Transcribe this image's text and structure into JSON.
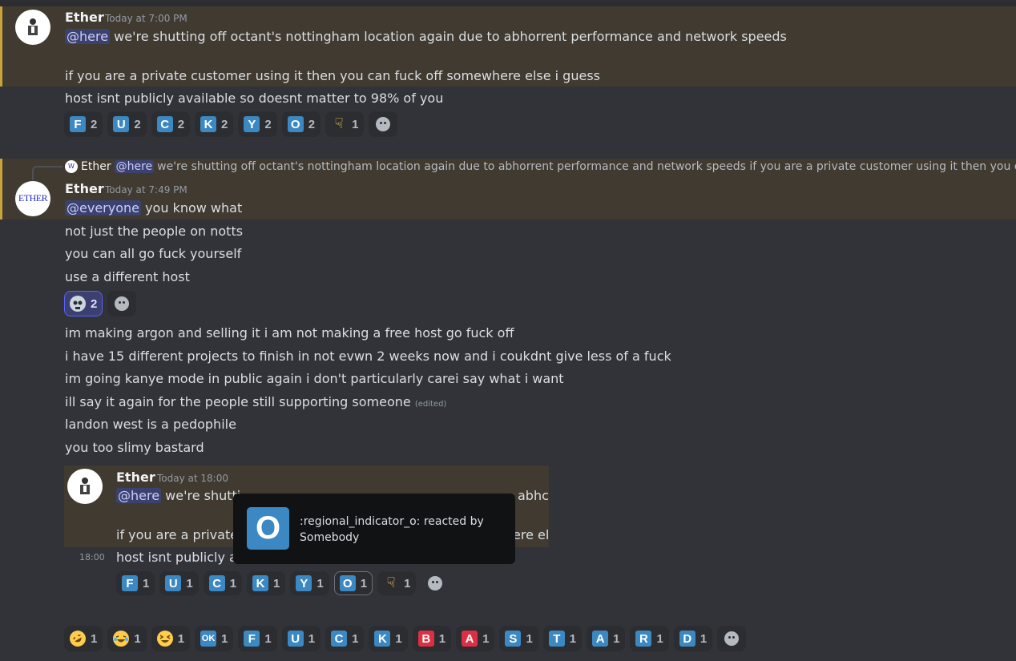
{
  "m1": {
    "username": "Ether",
    "timestamp": "Today at 7:00 PM",
    "mention": "@here",
    "line1": "we're shutting off octant's nottingham location again due to abhorrent performance and network speeds",
    "line2": "if you are a private customer using it then you can fuck off somewhere else i guess",
    "line3": "host isnt publicly available so doesnt matter to 98% of you",
    "reactions": [
      {
        "glyph": "F",
        "count": "2"
      },
      {
        "glyph": "U",
        "count": "2"
      },
      {
        "glyph": "C",
        "count": "2"
      },
      {
        "glyph": "K",
        "count": "2"
      },
      {
        "glyph": "Y",
        "count": "2"
      },
      {
        "glyph": "O",
        "count": "2"
      },
      {
        "icon": "middle-finger-icon",
        "count": "1"
      }
    ]
  },
  "reply": {
    "avatar_text": "W",
    "username": "Ether",
    "mention": "@here",
    "text": "we're shutting off octant's nottingham location again due to abhorrent performance and network speeds  if you are a private customer using it then you can fuc..."
  },
  "m2": {
    "username": "Ether",
    "timestamp": "Today at 7:49 PM",
    "avatar_text": "ETHER",
    "mention": "@everyone",
    "line1": "you know what",
    "line2": "not just the people on notts",
    "line3": "you can all go fuck yourself",
    "line4": "use a different host",
    "skull_count": "2",
    "line5": "im making argon and selling it i am not making a free host go fuck off",
    "line6": "i have 15 different projects to finish in not evwn 2 weeks now and i coukdnt give less of a fuck",
    "line7": "im going kanye mode in public again i don't particularly carei say what i want",
    "line8": "ill say it again for the people still supporting someone",
    "edited": "(edited)",
    "line9": "landon west is a pedophile",
    "line10": "you too slimy bastard"
  },
  "embed": {
    "username": "Ether",
    "timestamp": "Today at 18:00",
    "mention": "@here",
    "line1_a": "we're shutti",
    "line1_b": "abhc",
    "line2_a": "if you are a private c",
    "line2_b": "ere el",
    "side_time": "18:00",
    "line3": "host isnt publicly av",
    "reactions": [
      {
        "glyph": "F",
        "count": "1"
      },
      {
        "glyph": "U",
        "count": "1"
      },
      {
        "glyph": "C",
        "count": "1"
      },
      {
        "glyph": "K",
        "count": "1"
      },
      {
        "glyph": "Y",
        "count": "1"
      },
      {
        "glyph": "O",
        "count": "1"
      },
      {
        "icon": "middle-finger-icon",
        "count": "1"
      }
    ]
  },
  "tooltip": {
    "glyph": "O",
    "text": ":regional_indicator_o: reacted by Somebody"
  },
  "bottom_reactions": [
    {
      "icon": "rofl-icon",
      "count": "1"
    },
    {
      "icon": "joy-icon",
      "count": "1"
    },
    {
      "icon": "laughing-icon",
      "count": "1"
    },
    {
      "glyph": "OK",
      "count": "1"
    },
    {
      "glyph": "F",
      "count": "1"
    },
    {
      "glyph": "U",
      "count": "1"
    },
    {
      "glyph": "C",
      "count": "1"
    },
    {
      "glyph": "K",
      "count": "1"
    },
    {
      "glyph": "B",
      "count": "1",
      "red": true
    },
    {
      "glyph": "A",
      "count": "1",
      "red": true
    },
    {
      "glyph": "S",
      "count": "1"
    },
    {
      "glyph": "T",
      "count": "1"
    },
    {
      "glyph": "A",
      "count": "1"
    },
    {
      "glyph": "R",
      "count": "1"
    },
    {
      "glyph": "D",
      "count": "1"
    }
  ],
  "colors": {
    "background": "#313338",
    "highlight": "#403a30",
    "highlight_bar": "#c9a33a",
    "mention_bg": "#3c4270",
    "regional_blue": "#3b88c3",
    "regional_red": "#dd2e44"
  }
}
